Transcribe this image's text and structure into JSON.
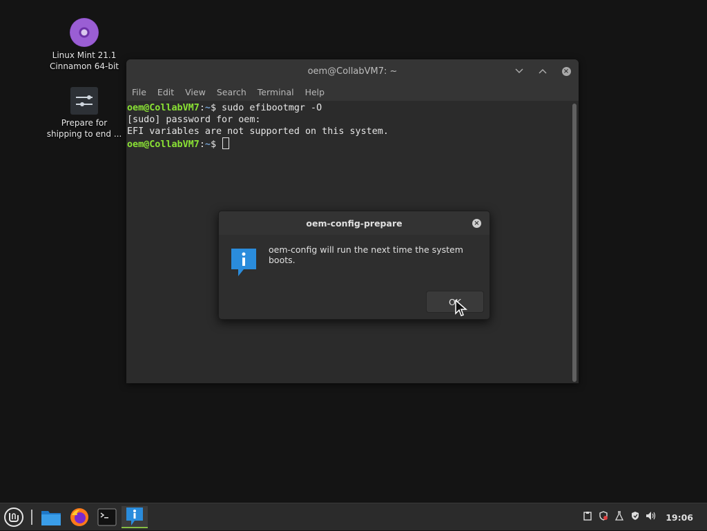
{
  "desktop": {
    "icons": [
      {
        "line1": "Linux Mint 21.1",
        "line2": "Cinnamon 64-bit",
        "icon": "dvd-icon"
      },
      {
        "line1": "Prepare for",
        "line2": "shipping to end ...",
        "icon": "settings-sliders-icon"
      }
    ]
  },
  "terminal": {
    "title": "oem@CollabVM7: ~",
    "menu": [
      "File",
      "Edit",
      "View",
      "Search",
      "Terminal",
      "Help"
    ],
    "lines": [
      {
        "user": "oem@CollabVM7",
        "sep": ":",
        "path": "~",
        "cmd": "$ sudo efibootmgr -O"
      },
      {
        "text": "[sudo] password for oem:"
      },
      {
        "text": "EFI variables are not supported on this system."
      },
      {
        "user": "oem@CollabVM7",
        "sep": ":",
        "path": "~",
        "cmd": "$ "
      }
    ]
  },
  "dialog": {
    "title": "oem-config-prepare",
    "message": "oem-config will run the next time the system boots.",
    "ok_label": "OK",
    "icon": "info-icon"
  },
  "taskbar": {
    "clock": "19:06",
    "apps": [
      "mint-menu-icon",
      "files-icon",
      "firefox-icon",
      "terminal-icon",
      "info-dialog-icon"
    ],
    "accent": "#86be43"
  }
}
